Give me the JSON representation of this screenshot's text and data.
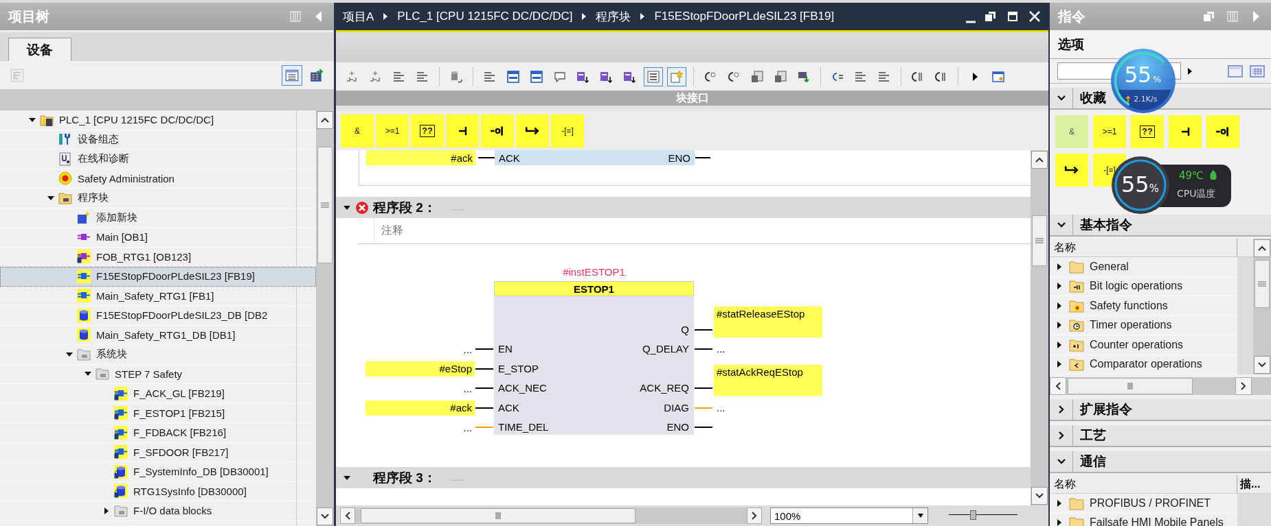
{
  "project_tree": {
    "title": "项目树",
    "tabs": [
      {
        "label": "设备",
        "selected": true
      }
    ],
    "toolbar": [
      {
        "kind": "tree-diagram",
        "disabled": true,
        "pressed": false
      },
      {
        "kind": "table",
        "disabled": false,
        "pressed": true
      },
      {
        "kind": "table-arrow",
        "disabled": false,
        "pressed": false
      }
    ],
    "items": [
      {
        "label": "PLC_1 [CPU 1215FC DC/DC/DC]",
        "kind": "plc",
        "expanded": true,
        "selected": false,
        "children": [
          {
            "label": "设备组态",
            "kind": "config",
            "selected": false
          },
          {
            "label": "在线和诊断",
            "kind": "diag",
            "selected": false
          },
          {
            "label": "Safety Administration",
            "kind": "safety",
            "selected": false
          },
          {
            "label": "程序块",
            "kind": "folder",
            "expanded": true,
            "selected": false,
            "children": [
              {
                "label": "添加新块",
                "kind": "add",
                "selected": false
              },
              {
                "label": "Main [OB1]",
                "kind": "ob",
                "selected": false
              },
              {
                "label": "FOB_RTG1 [OB123]",
                "kind": "ob-safe",
                "selected": false
              },
              {
                "label": "F15EStopFDoorPLdeSIL23 [FB19]",
                "kind": "fb",
                "selected": true
              },
              {
                "label": "Main_Safety_RTG1 [FB1]",
                "kind": "fb",
                "selected": false
              },
              {
                "label": "F15EStopFDoorPLdeSIL23_DB [DB2",
                "kind": "db",
                "selected": false
              },
              {
                "label": "Main_Safety_RTG1_DB [DB1]",
                "kind": "db",
                "selected": false
              },
              {
                "label": "系统块",
                "kind": "folder-gray",
                "expanded": true,
                "selected": false,
                "children": [
                  {
                    "label": "STEP 7 Safety",
                    "kind": "folder-gray",
                    "expanded": true,
                    "selected": false,
                    "children": [
                      {
                        "label": "F_ACK_GL [FB219]",
                        "kind": "fb-locked",
                        "selected": false
                      },
                      {
                        "label": "F_ESTOP1 [FB215]",
                        "kind": "fb-locked",
                        "selected": false
                      },
                      {
                        "label": "F_FDBACK [FB216]",
                        "kind": "fb-locked",
                        "selected": false
                      },
                      {
                        "label": "F_SFDOOR [FB217]",
                        "kind": "fb-locked",
                        "selected": false
                      },
                      {
                        "label": "F_SystemInfo_DB [DB30001]",
                        "kind": "db-locked",
                        "selected": false
                      },
                      {
                        "label": "RTG1SysInfo [DB30000]",
                        "kind": "db-locked",
                        "selected": false
                      },
                      {
                        "label": "F-I/O data blocks",
                        "kind": "folder-gray",
                        "expanded": false,
                        "selected": false
                      }
                    ]
                  }
                ]
              }
            ]
          }
        ]
      }
    ]
  },
  "editor": {
    "breadcrumb": [
      "项目A",
      "PLC_1 [CPU 1215FC DC/DC/DC]",
      "程序块",
      "F15EStopFDoorPLdeSIL23 [FB19]"
    ],
    "toolbar": [
      {
        "kind": "network",
        "pressed": false
      },
      {
        "kind": "network",
        "pressed": false
      },
      {
        "kind": "lines",
        "pressed": false
      },
      {
        "kind": "lines",
        "pressed": false
      },
      {
        "kind": "separator"
      },
      {
        "kind": "cylinder",
        "pressed": false
      },
      {
        "kind": "separator"
      },
      {
        "kind": "lines",
        "pressed": false
      },
      {
        "kind": "window",
        "pressed": false
      },
      {
        "kind": "window",
        "pressed": false
      },
      {
        "kind": "comment",
        "pressed": false
      },
      {
        "kind": "tag",
        "pressed": false
      },
      {
        "kind": "tag",
        "pressed": false
      },
      {
        "kind": "tag",
        "pressed": false
      },
      {
        "kind": "list",
        "pressed": true
      },
      {
        "kind": "star",
        "pressed": true
      },
      {
        "kind": "separator"
      },
      {
        "kind": "call",
        "pressed": false
      },
      {
        "kind": "call",
        "pressed": false
      },
      {
        "kind": "document",
        "pressed": false
      },
      {
        "kind": "document",
        "pressed": false
      },
      {
        "kind": "download",
        "pressed": false
      },
      {
        "kind": "separator"
      },
      {
        "kind": "goto",
        "pressed": false
      },
      {
        "kind": "lines",
        "pressed": false
      },
      {
        "kind": "lines",
        "pressed": false
      },
      {
        "kind": "separator"
      },
      {
        "kind": "bracket",
        "pressed": false
      },
      {
        "kind": "bracket",
        "pressed": false
      },
      {
        "kind": "separator"
      },
      {
        "kind": "more",
        "pressed": false
      },
      {
        "kind": "panel",
        "pressed": false
      }
    ],
    "interface_bar": "块接口",
    "favorites": [
      {
        "kind": "text",
        "label": "&"
      },
      {
        "kind": "text",
        "label": ">=1"
      },
      {
        "kind": "box",
        "label": "??"
      },
      {
        "kind": "contact"
      },
      {
        "kind": "negated"
      },
      {
        "kind": "branch"
      },
      {
        "kind": "text",
        "label": "-[=]"
      }
    ],
    "network_1": {
      "operand": "#ack",
      "pin_in": "ACK",
      "pin_out": "ENO"
    },
    "networks": [
      {
        "title": "程序段 2：",
        "dots": "......",
        "error": true,
        "expanded": true,
        "comment": "注释"
      },
      {
        "title": "程序段 3：",
        "dots": "......",
        "error": false,
        "expanded": true
      }
    ],
    "block": {
      "instance": "#instESTOP1",
      "name": "ESTOP1",
      "inputs": [
        {
          "kind": "empty"
        },
        {
          "kind": "bool",
          "pin": "EN",
          "operand": "...",
          "assigned": false
        },
        {
          "kind": "bool",
          "pin": "E_STOP",
          "operand": "#eStop",
          "assigned": true
        },
        {
          "kind": "bool",
          "pin": "ACK_NEC",
          "operand": "...",
          "assigned": false
        },
        {
          "kind": "bool",
          "pin": "ACK",
          "operand": "#ack",
          "assigned": true
        },
        {
          "kind": "struct",
          "pin": "TIME_DEL",
          "operand": "...",
          "assigned": false
        }
      ],
      "outputs": [
        {
          "kind": "bool",
          "pin": "Q",
          "operand": "#statReleaseEStop",
          "assigned": true
        },
        {
          "kind": "bool",
          "pin": "Q_DELAY",
          "operand": "...",
          "assigned": false
        },
        {
          "kind": "empty"
        },
        {
          "kind": "bool",
          "pin": "ACK_REQ",
          "operand": "#statAckReqEStop",
          "assigned": true
        },
        {
          "kind": "struct",
          "pin": "DIAG",
          "operand": "...",
          "assigned": false
        },
        {
          "kind": "bool",
          "pin": "ENO"
        }
      ]
    },
    "zoom": "100%",
    "zoom_slider": {
      "level": 0.35
    }
  },
  "instructions": {
    "title": "指令",
    "options_label": "选项",
    "sections": [
      {
        "kind": "favorites",
        "title": "收藏",
        "expanded": true,
        "tiles": [
          {
            "kind": "text",
            "label": "&",
            "highlighted": true
          },
          {
            "kind": "text",
            "label": ">=1",
            "highlighted": false
          },
          {
            "kind": "box",
            "label": "??",
            "highlighted": false
          },
          {
            "kind": "contact",
            "highlighted": false
          },
          {
            "kind": "negated",
            "highlighted": false
          },
          {
            "kind": "branch",
            "highlighted": false
          },
          {
            "kind": "text",
            "label": "-[=]",
            "highlighted": false
          }
        ]
      },
      {
        "kind": "scroll-table",
        "title": "基本指令",
        "expanded": true,
        "columns": [
          "名称"
        ],
        "rows": [
          {
            "label": "General",
            "kind": "folder",
            "expanded": false
          },
          {
            "label": "Bit logic operations",
            "kind": "folder-bit",
            "expanded": false
          },
          {
            "label": "Safety functions",
            "kind": "folder-safety",
            "expanded": false
          },
          {
            "label": "Timer operations",
            "kind": "folder-timer",
            "expanded": false
          },
          {
            "label": "Counter operations",
            "kind": "folder-counter",
            "expanded": false
          },
          {
            "label": "Comparator operations",
            "kind": "folder-compare",
            "expanded": false
          }
        ]
      },
      {
        "kind": "header",
        "title": "扩展指令",
        "expanded": false
      },
      {
        "kind": "header",
        "title": "工艺",
        "expanded": false
      },
      {
        "kind": "table",
        "title": "通信",
        "expanded": true,
        "columns": [
          "名称",
          "描..."
        ],
        "rows": [
          {
            "label": "PROFIBUS / PROFINET",
            "kind": "folder",
            "expanded": false
          },
          {
            "label": "Failsafe HMI Mobile Panels",
            "kind": "folder",
            "expanded": false
          }
        ]
      }
    ]
  },
  "monitor_widgets": [
    {
      "kind": "network",
      "value": "55",
      "unit": "%",
      "level": 0.55,
      "speed": "2.1K/s"
    },
    {
      "kind": "cpu",
      "value": "55",
      "unit": "%",
      "temperature": "49℃",
      "caption": "CPU温度"
    }
  ]
}
